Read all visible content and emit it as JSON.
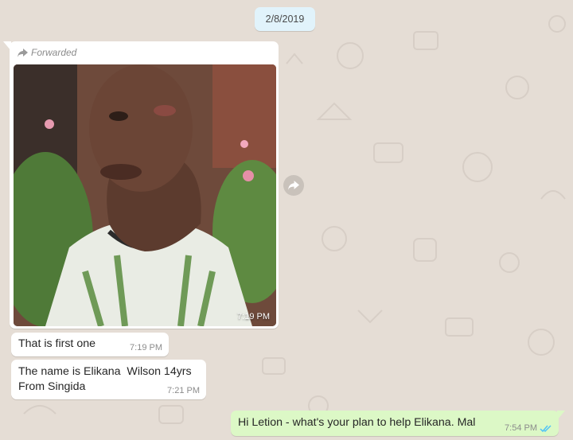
{
  "date_chip": "2/8/2019",
  "image_message": {
    "forwarded_label": "Forwarded",
    "time": "7:19 PM",
    "photo_description_icon": "photo"
  },
  "messages": [
    {
      "text": "That is first one",
      "time": "7:19 PM"
    },
    {
      "text_line1": "The name is Elikana  Wilson 14yrs",
      "text_line2": "From Singida",
      "time": "7:21 PM"
    }
  ],
  "outgoing": {
    "text": "Hi Letion - what's your plan to help Elikana. Mal",
    "time": "7:54 PM",
    "status_icon": "double-check-read"
  },
  "colors": {
    "chat_background": "#e5ddd5",
    "incoming_bubble": "#ffffff",
    "outgoing_bubble": "#dcf8c6",
    "date_chip": "#e1f3fb",
    "read_ticks": "#4fc3f7"
  }
}
